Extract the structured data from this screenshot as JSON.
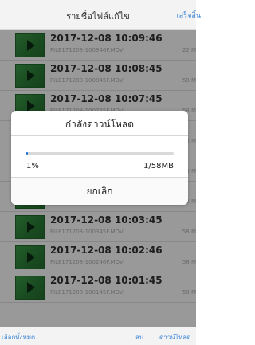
{
  "header": {
    "title": "รายชื่อไฟล์แก้ไข",
    "done_label": "เสร็จสิ้น"
  },
  "files": [
    {
      "datetime": "2017-12-08 10:09:46",
      "filename": "FILE171208-100946F.MOV",
      "size": "22 M"
    },
    {
      "datetime": "2017-12-08 10:08:45",
      "filename": "FILE171208-100845F.MOV",
      "size": "58 M"
    },
    {
      "datetime": "2017-12-08 10:07:45",
      "filename": "FILE171208-100745F.MOV",
      "size": "58 M"
    },
    {
      "datetime": "",
      "filename": "",
      "size": "58 M"
    },
    {
      "datetime": "",
      "filename": "",
      "size": "58 M"
    },
    {
      "datetime": "",
      "filename": "",
      "size": "58 M"
    },
    {
      "datetime": "2017-12-08 10:03:45",
      "filename": "FILE171208-100345F.MOV",
      "size": "58 M"
    },
    {
      "datetime": "2017-12-08 10:02:46",
      "filename": "FILE171208-100246F.MOV",
      "size": "58 M"
    },
    {
      "datetime": "2017-12-08 10:01:45",
      "filename": "FILE171208-100145F.MOV",
      "size": "58 M"
    }
  ],
  "dialog": {
    "title": "กำลังดาวน์โหลด",
    "percent_label": "1%",
    "progress": 0.01,
    "amount": "1/58MB",
    "cancel_label": "ยกเลิก"
  },
  "bottom": {
    "select_all_label": "เลือกทั้งหมด",
    "delete_label": "ลบ",
    "download_label": "ดาวน์โหลด"
  },
  "colors": {
    "accent": "#3c86d6",
    "thumb": "#2e8b3c",
    "progress": "#1a6fd6"
  }
}
